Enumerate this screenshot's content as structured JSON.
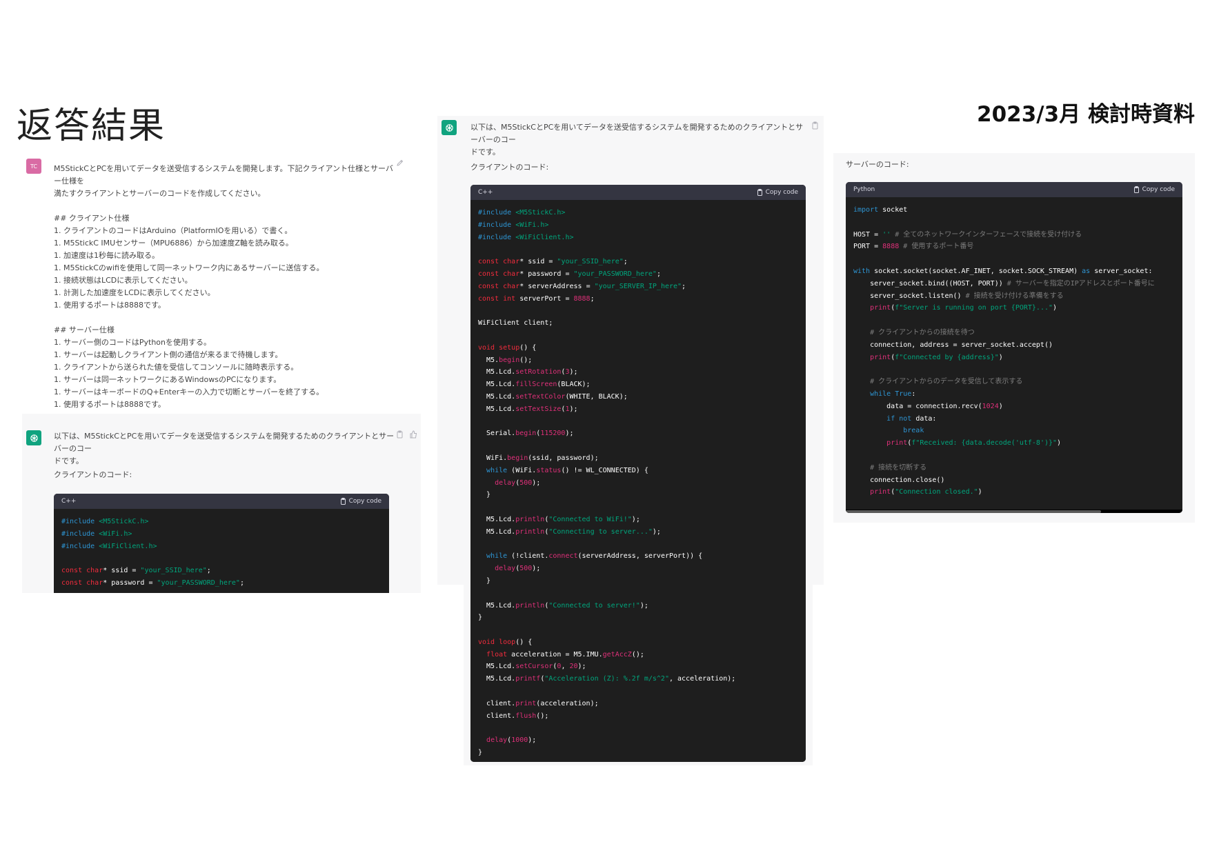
{
  "slide_title": "返答結果",
  "date_title": "2023/3月 検討時資料",
  "left": {
    "user_avatar": "TC",
    "user_message": "M5StickCとPCを用いてデータを送受信するシステムを開発します。下記クライアント仕様とサーバー仕様を\n満たすクライアントとサーバーのコードを作成してください。\n\n## クライアント仕様\n1. クライアントのコードはArduino（PlatformIOを用いる）で書く。\n1. M5StickC IMUセンサー（MPU6886）から加速度Z軸を読み取る。\n1. 加速度は1秒毎に読み取る。\n1. M5StickCのwifiを使用して同一ネットワーク内にあるサーバーに送信する。\n1. 接続状態はLCDに表示してください。\n1. 計測した加速度をLCDに表示してください。\n1. 使用するポートは8888です。\n\n## サーバー仕様\n1. サーバー側のコードはPythonを使用する。\n1. サーバーは起動しクライアント側の通信が来るまで待機します。\n1. クライアントから送られた値を受信してコンソールに随時表示する。\n1. サーバーは同一ネットワークにあるWindowsのPCになります。\n1. サーバーはキーボードのQ+Enterキーの入力で切断とサーバーを終了する。\n1. 使用するポートは8888です。",
    "assistant_message": "以下は、M5StickCとPCを用いてデータを送受信するシステムを開発するためのクライアントとサーバーのコー\nドです。",
    "client_label": "クライアントのコード:",
    "code_lang": "C++",
    "copy_label": "Copy code"
  },
  "middle": {
    "assistant_message": "以下は、M5StickCとPCを用いてデータを送受信するシステムを開発するためのクライアントとサーバーのコー\nドです。",
    "client_label": "クライアントのコード:",
    "code_lang": "C++",
    "copy_label": "Copy code"
  },
  "right": {
    "server_label": "サーバーのコード:",
    "code_lang": "Python",
    "copy_label": "Copy code"
  },
  "icons": {
    "edit": "edit-icon",
    "copy": "clipboard-icon",
    "thumb": "thumbs-up-icon",
    "gpt": "openai-logo-icon"
  }
}
